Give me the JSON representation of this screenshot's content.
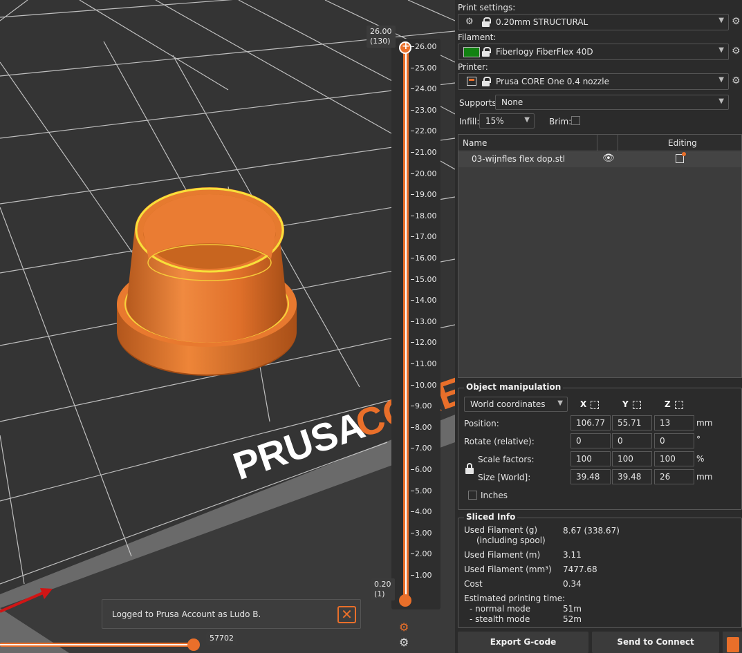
{
  "viewport": {
    "bed_logo_word1": "PRUSA",
    "bed_logo_word2": "CORE",
    "vertical_slider": {
      "top_value": "26.00",
      "top_layer": "(130)",
      "bottom_value": "0.20",
      "bottom_layer": "(1)",
      "ticks": [
        "26.00",
        "25.00",
        "24.00",
        "23.00",
        "22.00",
        "21.00",
        "20.00",
        "19.00",
        "18.00",
        "17.00",
        "16.00",
        "15.00",
        "14.00",
        "13.00",
        "12.00",
        "11.00",
        "10.00",
        "9.00",
        "8.00",
        "7.00",
        "6.00",
        "5.00",
        "4.00",
        "3.00",
        "2.00",
        "1.00"
      ]
    },
    "horizontal_slider": {
      "value": "57702"
    },
    "notification": {
      "message": "Logged to Prusa Account as Ludo B."
    },
    "colors": {
      "accent": "#e96f2a",
      "model": "#e67328",
      "bed": "#323232"
    }
  },
  "panel": {
    "print_settings": {
      "label": "Print settings:",
      "value": "0.20mm STRUCTURAL"
    },
    "filament": {
      "label": "Filament:",
      "value": "Fiberlogy FiberFlex 40D",
      "color": "#128212"
    },
    "printer": {
      "label": "Printer:",
      "value": "Prusa CORE One 0.4 nozzle"
    },
    "supports": {
      "label": "Supports:",
      "value": "None"
    },
    "infill": {
      "label": "Infill:",
      "value": "15%"
    },
    "brim": {
      "label": "Brim:"
    },
    "object_list": {
      "col_name": "Name",
      "col_editing": "Editing",
      "rows": [
        {
          "name": "03-wijnfles flex dop.stl"
        }
      ]
    },
    "object_manipulation": {
      "title": "Object manipulation",
      "coord_system": "World coordinates",
      "axes": [
        "X",
        "Y",
        "Z"
      ],
      "position": {
        "label": "Position:",
        "x": "106.77",
        "y": "55.71",
        "z": "13",
        "unit": "mm"
      },
      "rotate": {
        "label": "Rotate (relative):",
        "x": "0",
        "y": "0",
        "z": "0",
        "unit": "°"
      },
      "scale": {
        "label": "Scale factors:",
        "x": "100",
        "y": "100",
        "z": "100",
        "unit": "%"
      },
      "size": {
        "label": "Size [World]:",
        "x": "39.48",
        "y": "39.48",
        "z": "26",
        "unit": "mm"
      },
      "inches_label": "Inches"
    },
    "sliced_info": {
      "title": "Sliced Info",
      "used_filament_g_label": "Used Filament (g)",
      "including_spool_label": "(including spool)",
      "used_filament_g": "8.67 (338.67)",
      "used_filament_m_label": "Used Filament (m)",
      "used_filament_m": "3.11",
      "used_filament_mm3_label": "Used Filament (mm³)",
      "used_filament_mm3": "7477.68",
      "cost_label": "Cost",
      "cost": "0.34",
      "est_time_label": "Estimated printing time:",
      "normal_mode_label": "- normal mode",
      "normal_mode": "51m",
      "stealth_mode_label": "- stealth mode",
      "stealth_mode": "52m"
    },
    "buttons": {
      "export": "Export G-code",
      "send": "Send to Connect"
    }
  }
}
